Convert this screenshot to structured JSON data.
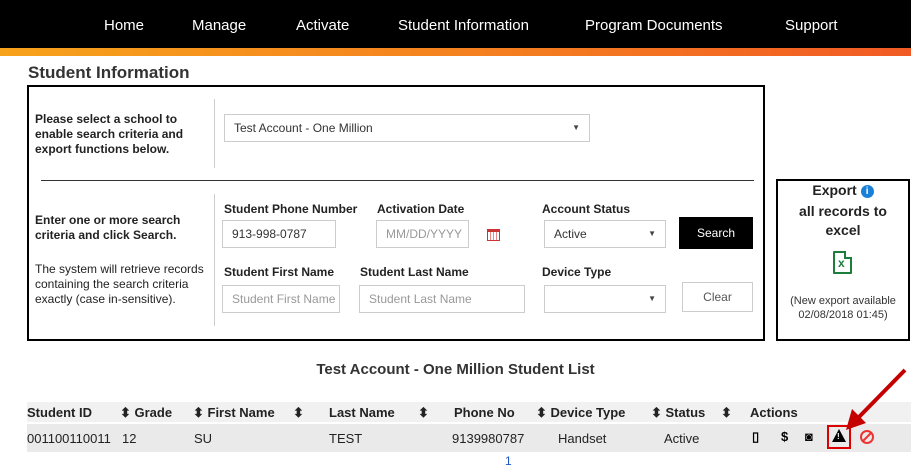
{
  "nav": {
    "items": [
      "Home",
      "Manage",
      "Activate",
      "Student Information",
      "Program Documents",
      "Support"
    ]
  },
  "page": {
    "title": "Student Information"
  },
  "search": {
    "school_prompt": "Please select a school to enable search criteria and export functions below.",
    "school_selected": "Test Account - One Million",
    "criteria_prompt": "Enter one or more search criteria and click Search.",
    "criteria_note": "The system will retrieve records containing the search criteria exactly (case in-sensitive).",
    "phone_label": "Student Phone Number",
    "phone_value": "913-998-0787",
    "activation_label": "Activation Date",
    "activation_placeholder": "MM/DD/YYYY",
    "status_label": "Account Status",
    "status_value": "Active",
    "search_button": "Search",
    "first_name_label": "Student First Name",
    "first_name_placeholder": "Student First Name",
    "last_name_label": "Student Last Name",
    "last_name_placeholder": "Student Last Name",
    "device_label": "Device Type",
    "device_value": "",
    "clear_button": "Clear"
  },
  "export": {
    "title_line1": "Export",
    "title_line2": "all records to",
    "title_line3": "excel",
    "info_glyph": "i",
    "excel_glyph": "x",
    "note_line1": "(New export available",
    "note_line2": "02/08/2018 01:45)"
  },
  "list": {
    "title": "Test Account - One Million  Student List",
    "headers": [
      "Student ID",
      "⬍ Grade",
      "⬍ First Name",
      "⬍",
      "Last Name",
      "⬍",
      "Phone No",
      "⬍ Device Type",
      "⬍ Status",
      "⬍",
      "Actions"
    ],
    "row": {
      "student_id": "001100110011",
      "grade": "12",
      "first_name": "SU",
      "last_name": "TEST",
      "phone": "9139980787",
      "device": "Handset",
      "status": "Active"
    },
    "actions": {
      "device": "▯",
      "payment": "$",
      "document": "◙"
    },
    "page": "1"
  },
  "colors": {
    "nav_bg": "#000000",
    "accent": "#f47b20",
    "link": "#1a56c7",
    "alert": "#dd0000",
    "excel": "#1d7d3c"
  }
}
